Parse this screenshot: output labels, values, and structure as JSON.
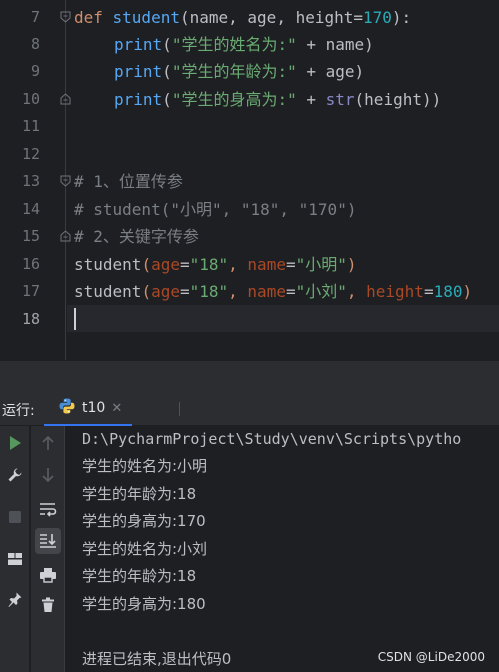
{
  "editor": {
    "line_numbers": [
      "7",
      "8",
      "9",
      "10",
      "11",
      "12",
      "13",
      "14",
      "15",
      "16",
      "17",
      "18"
    ],
    "code": {
      "l7": {
        "kw": "def ",
        "fn": "student",
        "p1": "(",
        "a1": "name",
        "c1": ", ",
        "a2": "age",
        "c2": ", ",
        "a3": "height",
        "eq": "=",
        "n1": "170",
        "p2": "):"
      },
      "l8": {
        "call": "print",
        "p1": "(",
        "s": "\"学生的姓名为:\"",
        "op": " + ",
        "v": "name",
        "p2": ")"
      },
      "l9": {
        "call": "print",
        "p1": "(",
        "s": "\"学生的年龄为:\"",
        "op": " + ",
        "v": "age",
        "p2": ")"
      },
      "l10": {
        "call": "print",
        "p1": "(",
        "s": "\"学生的身高为:\"",
        "op": " + ",
        "b": "str",
        "p2": "(",
        "v": "height",
        "p3": "))"
      },
      "l13": "# 1、位置传参",
      "l14": "# student(\"小明\", \"18\", \"170\")",
      "l15": "# 2、关键字传参",
      "l16": {
        "f": "student",
        "p1": "(",
        "k1": "age",
        "eq1": "=",
        "s1": "\"18\"",
        "c1": ", ",
        "k2": "name",
        "eq2": "=",
        "s2": "\"小明\"",
        "p2": ")"
      },
      "l17": {
        "f": "student",
        "p1": "(",
        "k1": "age",
        "eq1": "=",
        "s1": "\"18\"",
        "c1": ", ",
        "k2": "name",
        "eq2": "=",
        "s2": "\"小刘\"",
        "c2": ", ",
        "k3": "height",
        "eq3": "=",
        "n3": "180",
        "p2": ")"
      }
    },
    "current_line": "18",
    "colors": {
      "keyword": "#cf8e6d",
      "function": "#56a8f5",
      "number": "#2aacb8",
      "string": "#6aab73",
      "comment": "#7a7e85",
      "named_arg": "#aa4926",
      "builtin": "#8888c6"
    }
  },
  "run_panel": {
    "label": "运行:",
    "tab": {
      "label": "t10",
      "close": "✕",
      "icon": "python-icon"
    },
    "left_toolbar": [
      "run-icon",
      "wrench-icon",
      "stop-icon",
      "layout-icon",
      "pin-icon"
    ],
    "right_toolbar": [
      "arrow-up-icon",
      "arrow-down-icon",
      "soft-wrap-icon",
      "scroll-to-end-icon",
      "print-icon",
      "trash-icon"
    ],
    "output": [
      "D:\\PycharmProject\\Study\\venv\\Scripts\\pytho",
      "学生的姓名为:小明",
      "学生的年龄为:18",
      "学生的身高为:170",
      "学生的姓名为:小刘",
      "学生的年龄为:18",
      "学生的身高为:180",
      "",
      "进程已结束,退出代码0"
    ]
  },
  "watermark": "CSDN @LiDe2000"
}
